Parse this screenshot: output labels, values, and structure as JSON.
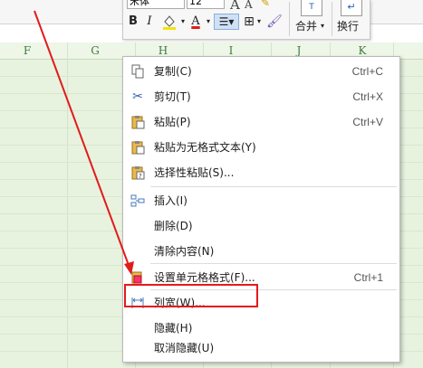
{
  "toolbar": {
    "font_name": "宋体",
    "font_size": "12",
    "bold_label": "B",
    "italic_label": "I",
    "font_color_label": "A",
    "merge_label": "合并",
    "wrap_label": "换行",
    "merge_icon_text": "T"
  },
  "columns": [
    "F",
    "G",
    "H",
    "I",
    "J",
    "K"
  ],
  "menu": {
    "items": [
      {
        "label": "复制(C)",
        "shortcut": "Ctrl+C",
        "icon": "copy-icon"
      },
      {
        "label": "剪切(T)",
        "shortcut": "Ctrl+X",
        "icon": "scissors-icon"
      },
      {
        "label": "粘贴(P)",
        "shortcut": "Ctrl+V",
        "icon": "paste-icon"
      },
      {
        "label": "粘贴为无格式文本(Y)",
        "shortcut": "",
        "icon": "paste-plain-icon"
      },
      {
        "label": "选择性粘贴(S)...",
        "shortcut": "",
        "icon": "paste-special-icon"
      },
      {
        "label": "插入(I)",
        "shortcut": "",
        "icon": "insert-icon"
      },
      {
        "label": "删除(D)",
        "shortcut": "",
        "icon": ""
      },
      {
        "label": "清除内容(N)",
        "shortcut": "",
        "icon": ""
      },
      {
        "label": "设置单元格格式(F)...",
        "shortcut": "Ctrl+1",
        "icon": "format-cells-icon"
      },
      {
        "label": "列宽(W)...",
        "shortcut": "",
        "icon": "column-width-icon"
      },
      {
        "label": "隐藏(H)",
        "shortcut": "",
        "icon": ""
      },
      {
        "label": "取消隐藏(U)",
        "shortcut": "",
        "icon": ""
      }
    ]
  },
  "colors": {
    "highlight": "#e21b1b",
    "arrow": "#e21b1b",
    "grid_bg": "#e8f3df"
  }
}
